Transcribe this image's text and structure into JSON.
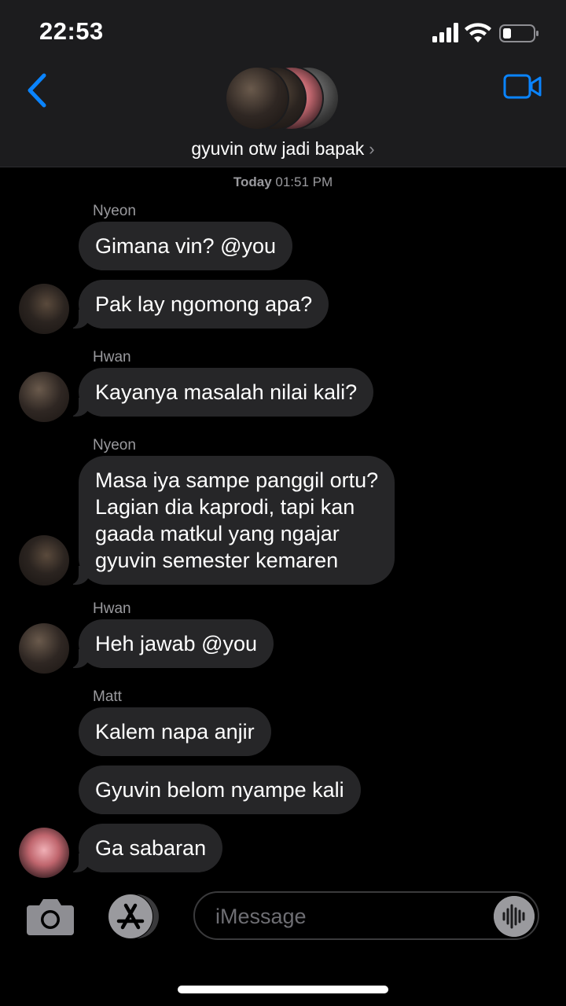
{
  "status_bar": {
    "time": "22:53"
  },
  "header": {
    "group_name": "gyuvin otw jadi bapak",
    "chevron": "›"
  },
  "conversation": {
    "timestamp_day": "Today",
    "timestamp_time": "01:51 PM",
    "senders": [
      "Nyeon",
      "Hwan",
      "Nyeon",
      "Hwan",
      "Matt"
    ],
    "messages": [
      "Gimana vin? @you",
      "Pak lay ngomong apa?",
      "Kayanya masalah nilai kali?",
      "Masa iya sampe panggil ortu?\nLagian dia kaprodi, tapi kan\ngaada matkul yang ngajar\ngyuvin semester kemaren",
      "Heh jawab @you",
      "Kalem napa anjir",
      "Gyuvin belom nyampe kali",
      "Ga sabaran"
    ]
  },
  "composer": {
    "placeholder": "iMessage"
  },
  "icons": [
    "signal-icon",
    "wifi-icon",
    "battery-icon",
    "back-chevron-icon",
    "video-camera-icon",
    "camera-icon",
    "app-store-icon",
    "audio-waveform-icon"
  ],
  "colors": {
    "accent": "#0a84ff",
    "bubble": "#262628",
    "background": "#000000",
    "header": "#1c1c1e"
  }
}
